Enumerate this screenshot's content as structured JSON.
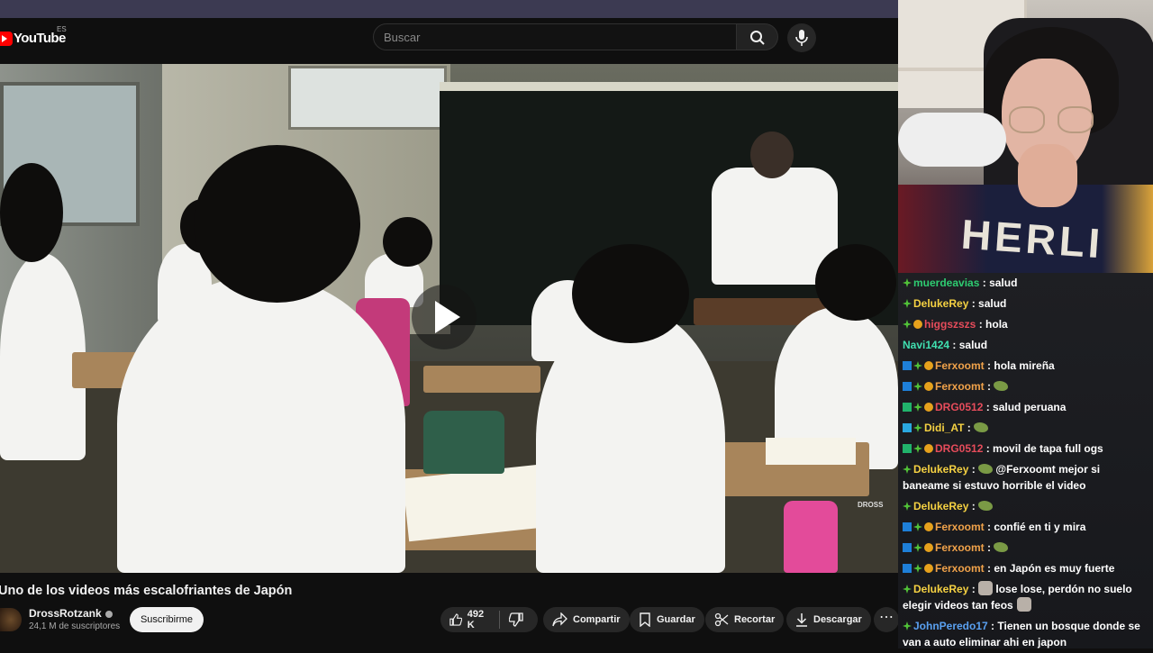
{
  "youtube": {
    "logo_text": "YouTube",
    "country_code": "ES",
    "search_placeholder": "Buscar",
    "video": {
      "watermark": "DROSS"
    },
    "title": "Uno de los videos más escalofriantes de Japón",
    "channel": {
      "name": "DrossRotzank",
      "subscribers": "24,1 M de suscriptores"
    },
    "subscribe_label": "Suscribirme",
    "likes": "492 K",
    "actions": {
      "share": "Compartir",
      "save": "Guardar",
      "clip": "Recortar",
      "download": "Descargar"
    },
    "more_label": "⋯"
  },
  "webcam": {
    "shirt_text": "HERLI"
  },
  "chat": {
    "messages": [
      {
        "user": "muerdeavias",
        "color": "#2ecc71",
        "text": "salud"
      },
      {
        "user": "DelukeRey",
        "color": "#f5d142",
        "text": "salud"
      },
      {
        "user": "higgszszs",
        "color": "#e74c5b",
        "text": "hola"
      },
      {
        "user": "Navi1424",
        "color": "#40e0b0",
        "text": "salud"
      },
      {
        "user": "Ferxoomt",
        "color": "#f0a24a",
        "text": "hola mireña"
      },
      {
        "user": "Ferxoomt",
        "color": "#f0a24a",
        "text": ""
      },
      {
        "user": "DRG0512",
        "color": "#e74c5b",
        "text": "salud peruana"
      },
      {
        "user": "Didi_AT",
        "color": "#f5d142",
        "text": ""
      },
      {
        "user": "DRG0512",
        "color": "#e74c5b",
        "text": "movil de tapa full ogs"
      },
      {
        "user": "DelukeRey",
        "color": "#f5d142",
        "text": "@Ferxoomt mejor si baneame si estuvo horrible el video"
      },
      {
        "user": "DelukeRey",
        "color": "#f5d142",
        "text": ""
      },
      {
        "user": "Ferxoomt",
        "color": "#f0a24a",
        "text": "confié en ti y mira"
      },
      {
        "user": "Ferxoomt",
        "color": "#f0a24a",
        "text": ""
      },
      {
        "user": "Ferxoomt",
        "color": "#f0a24a",
        "text": "en Japón es muy fuerte"
      },
      {
        "user": "DelukeRey",
        "color": "#f5d142",
        "text": "lose lose, perdón no suelo elegir videos tan feos"
      },
      {
        "user": "JohnPeredo17",
        "color": "#5aa0f0",
        "text": "Tienen un bosque donde se van a auto eliminar ahi en japon"
      }
    ]
  }
}
